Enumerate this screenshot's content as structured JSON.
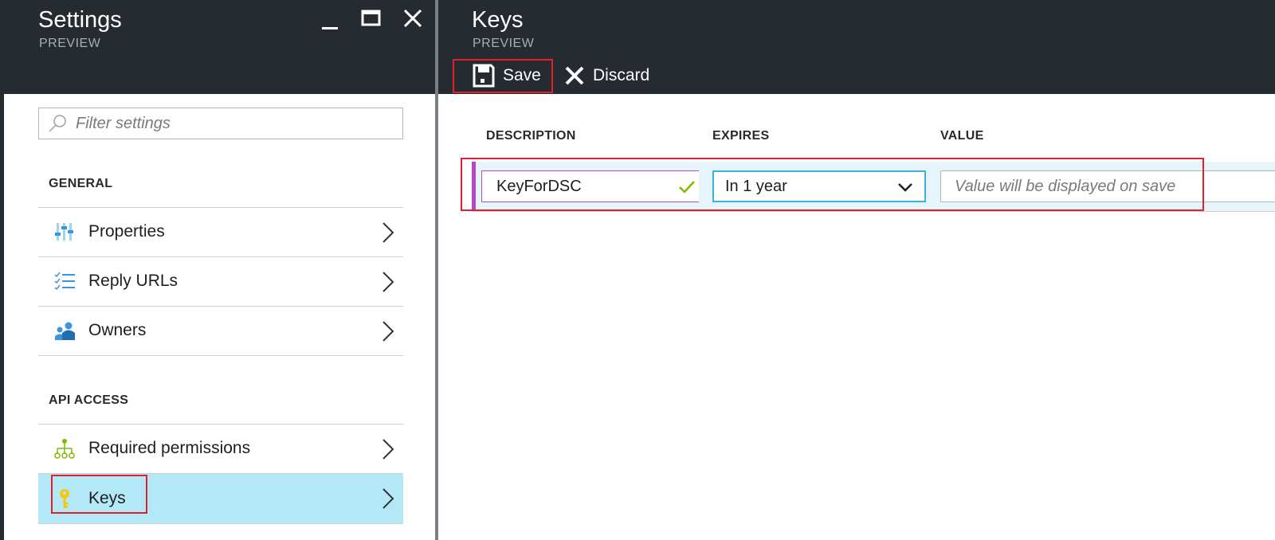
{
  "settings_blade": {
    "title": "Settings",
    "subtitle": "PREVIEW",
    "filter": {
      "placeholder": "Filter settings",
      "value": ""
    },
    "sections": [
      {
        "label": "GENERAL",
        "items": [
          {
            "label": "Properties",
            "icon": "properties-icon"
          },
          {
            "label": "Reply URLs",
            "icon": "reply-urls-icon"
          },
          {
            "label": "Owners",
            "icon": "owners-icon"
          }
        ]
      },
      {
        "label": "API ACCESS",
        "items": [
          {
            "label": "Required permissions",
            "icon": "permissions-icon"
          },
          {
            "label": "Keys",
            "icon": "key-icon",
            "selected": true
          }
        ]
      }
    ]
  },
  "keys_blade": {
    "title": "Keys",
    "subtitle": "PREVIEW",
    "toolbar": {
      "save_label": "Save",
      "discard_label": "Discard"
    },
    "columns": {
      "description": "DESCRIPTION",
      "expires": "EXPIRES",
      "value": "VALUE"
    },
    "row": {
      "description": "KeyForDSC",
      "expires": "In 1 year",
      "value_placeholder": "Value will be displayed on save"
    }
  },
  "colors": {
    "header_bg": "#262b31",
    "selected_bg": "#b3e8f7",
    "highlight_red": "#e0202a",
    "accent_purple": "#b648c8",
    "focus_blue": "#3bb3e0",
    "valid_green": "#7fba00"
  }
}
